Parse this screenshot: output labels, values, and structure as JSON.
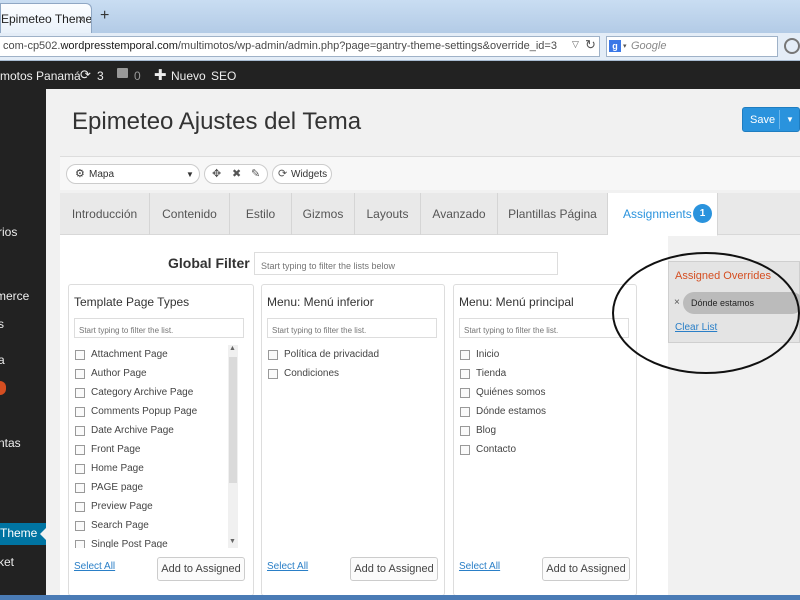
{
  "browser": {
    "tab_title": "Epimeteo Theme ...",
    "tab_close": "×",
    "new_tab": "+",
    "url_prefix": "com-cp502.",
    "url_domain": "wordpresstemporal.com",
    "url_path": "/multimotos/wp-admin/admin.php?page=gantry-theme-settings&override_id=3",
    "url_dropdown_icon": "▽",
    "refresh_icon": "↻",
    "search_engine_letter": "g",
    "search_dropdown": "▾",
    "search_placeholder": "Google"
  },
  "adminbar": {
    "site_name": "motos Panamá",
    "updates_count": "3",
    "comments_count": "0",
    "new_label": "Nuevo",
    "seo_label": "SEO"
  },
  "adminmenu": {
    "items": [
      "rios",
      "merce",
      "s",
      "a",
      "ntas"
    ],
    "active_label": "Theme",
    "last_label": "ket"
  },
  "page": {
    "title": "Epimeteo Ajustes del Tema",
    "save_label": "Save",
    "save_caret": "▼"
  },
  "toolbar": {
    "map_icon": "⚙",
    "map_label": "Mapa",
    "map_caret": "▼",
    "icons": [
      "✥",
      "✖",
      "✎"
    ],
    "widgets_icon": "⟳",
    "widgets_label": "Widgets"
  },
  "tabs": [
    {
      "label": "Introducción"
    },
    {
      "label": "Contenido"
    },
    {
      "label": "Estilo"
    },
    {
      "label": "Gizmos"
    },
    {
      "label": "Layouts"
    },
    {
      "label": "Avanzado"
    },
    {
      "label": "Plantillas Página"
    },
    {
      "label": "Assignments",
      "badge": "1"
    }
  ],
  "global_filter": {
    "label": "Global Filter",
    "placeholder": "Start typing to filter the lists below"
  },
  "columns": [
    {
      "title": "Template Page Types",
      "placeholder": "Start typing to filter the list.",
      "items": [
        "Attachment Page",
        "Author Page",
        "Category Archive Page",
        "Comments Popup Page",
        "Date Archive Page",
        "Front Page",
        "Home Page",
        "PAGE page",
        "Preview Page",
        "Search Page",
        "Single Post Page"
      ],
      "select_all": "Select All",
      "add_label": "Add to Assigned"
    },
    {
      "title": "Menu: Menú inferior",
      "placeholder": "Start typing to filter the list.",
      "items": [
        "Política de privacidad",
        "Condiciones"
      ],
      "select_all": "Select All",
      "add_label": "Add to Assigned"
    },
    {
      "title": "Menu: Menú principal",
      "placeholder": "Start typing to filter the list.",
      "items": [
        "Inicio",
        "Tienda",
        "Quiénes somos",
        "Dónde estamos",
        "Blog",
        "Contacto"
      ],
      "select_all": "Select All",
      "add_label": "Add to Assigned"
    }
  ],
  "overrides": {
    "title": "Assigned Overrides",
    "remove_icon": "×",
    "item": "Dónde estamos",
    "clear_label": "Clear List"
  },
  "colors": {
    "accent": "#2a93dd",
    "admin_bar": "#222222",
    "overrides_title": "#d54e21"
  }
}
